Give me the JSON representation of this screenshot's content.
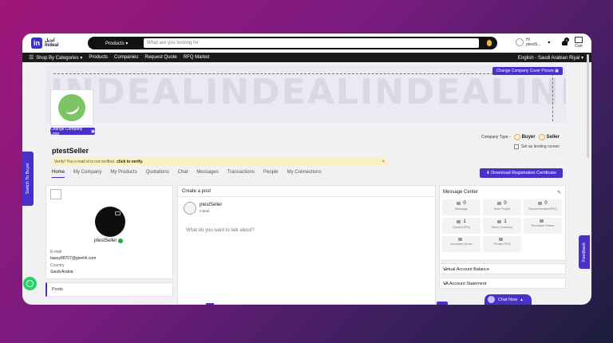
{
  "header": {
    "logo_arabic": "انديل",
    "logo_text": "Indeal",
    "search_category": "Products",
    "search_placeholder": "What are you looking for",
    "user_greeting": "Hi",
    "user_name": "ptestS...",
    "notification_count": "0",
    "cart_label": "Cart"
  },
  "nav": {
    "items": [
      "Shop By Categories",
      "Products",
      "Companies",
      "Request Quote",
      "RFQ Market"
    ],
    "language": "English - Saudi Arabian Riyal"
  },
  "cover": {
    "watermark": "INDEALINDEALINDEALINDEAL",
    "change_cover_label": "Change Company Cover Picture",
    "change_logo_label": "Change Company Logo"
  },
  "company_type": {
    "label": "Company Type -",
    "options": [
      "Buyer",
      "Seller"
    ],
    "landing_label": "Set as landing screen"
  },
  "profile": {
    "name": "ptestSeller",
    "verify_text": "Verify! You e-mail id is not verified.",
    "verify_link": "click to verify.",
    "email_label": "E-mail",
    "email_value": "bassy88707@givehit.com",
    "country_label": "Country",
    "country_value": "Saudi Arabia"
  },
  "tabs": [
    "Home",
    "My Company",
    "My Products",
    "Quotations",
    "Chat",
    "Messages",
    "Transactions",
    "People",
    "My Connections"
  ],
  "download_label": "Download Registration Certificate",
  "posts_label": "Posts",
  "post": {
    "title": "Create a post",
    "author": "ptestSeller",
    "author_sub": "Indeal",
    "prompt": "What do you want to talk about?"
  },
  "message_center": {
    "title": "Message Center",
    "cells": [
      {
        "value": "0",
        "label": "Message"
      },
      {
        "value": "0",
        "label": "New People"
      },
      {
        "value": "0",
        "label": "Recommendent RFQ"
      },
      {
        "value": "1",
        "label": "Quoted RFQ"
      },
      {
        "value": "1",
        "label": "Sales Summary"
      },
      {
        "value": "",
        "label": "Purchase Orders"
      },
      {
        "value": "",
        "label": "Accepted Quote"
      },
      {
        "value": "",
        "label": "Private RFQ"
      }
    ]
  },
  "accordions": [
    "Virtual Account Balance",
    "VA Account Statement"
  ],
  "side_tab": "Switch To Buyer",
  "feedback": "Feedback",
  "chat_now": "Chat Now"
}
